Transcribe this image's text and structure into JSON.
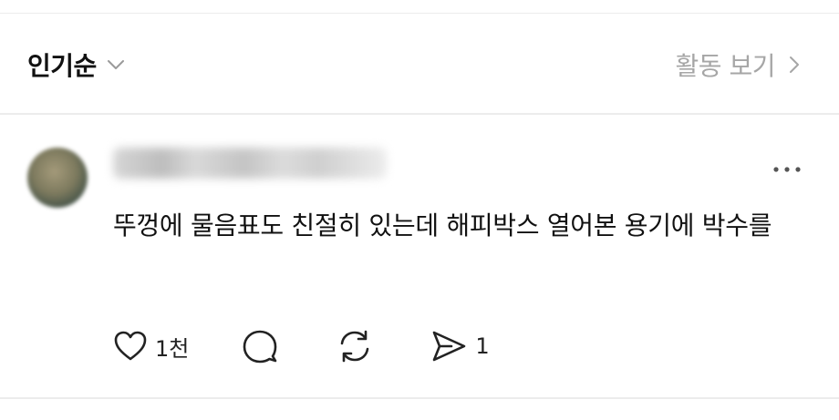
{
  "header": {
    "sort_label": "인기순",
    "sort_icon": "chevron-down-icon",
    "activity_label": "활동 보기",
    "activity_icon": "chevron-right-icon"
  },
  "comment": {
    "username": "",
    "avatar": "avatar-image-blurred",
    "more_icon": "more-horizontal-icon",
    "text": "뚜껑에 물음표도 친절히 있는데 해피박스 열어본 용기에 박수를",
    "actions": {
      "like_icon": "heart-icon",
      "like_count": "1천",
      "reply_icon": "comment-bubble-icon",
      "repost_icon": "repost-icon",
      "share_icon": "send-icon",
      "share_count": "1"
    }
  },
  "colors": {
    "text_primary": "#111111",
    "text_secondary": "#a6a6a6",
    "divider": "#ececec",
    "background": "#ffffff"
  }
}
